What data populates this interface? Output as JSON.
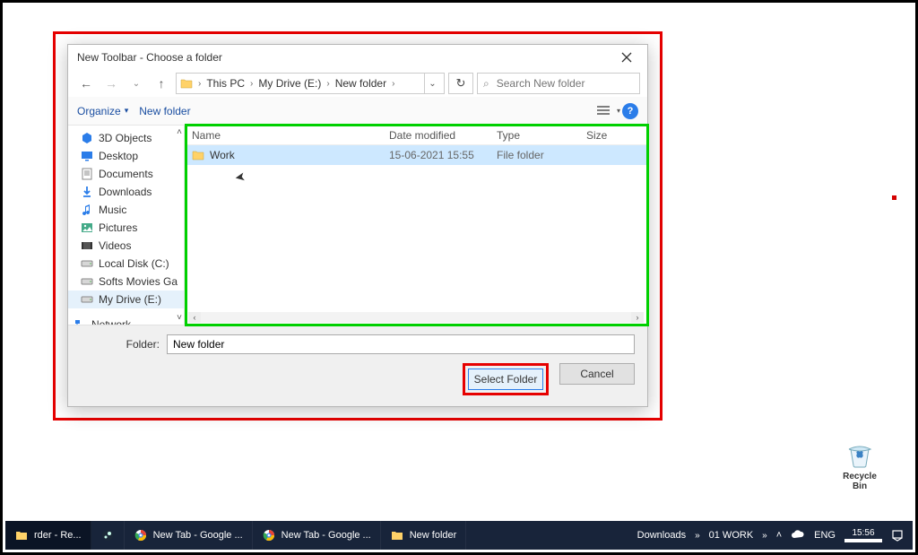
{
  "dialog": {
    "title": "New Toolbar - Choose a folder",
    "breadcrumb": {
      "root": "This PC",
      "drive": "My Drive (E:)",
      "folder": "New folder"
    },
    "search_placeholder": "Search New folder",
    "commands": {
      "organize": "Organize",
      "newfolder": "New folder"
    },
    "tree": [
      {
        "label": "3D Objects",
        "icon": "cube",
        "color": "#2b7de9"
      },
      {
        "label": "Desktop",
        "icon": "desktop",
        "color": "#2b7de9"
      },
      {
        "label": "Documents",
        "icon": "doc",
        "color": "#6d6d6d"
      },
      {
        "label": "Downloads",
        "icon": "download",
        "color": "#2b7de9"
      },
      {
        "label": "Music",
        "icon": "music",
        "color": "#2b7de9"
      },
      {
        "label": "Pictures",
        "icon": "picture",
        "color": "#4a8"
      },
      {
        "label": "Videos",
        "icon": "video",
        "color": "#555"
      },
      {
        "label": "Local Disk (C:)",
        "icon": "disk",
        "color": "#888"
      },
      {
        "label": "Softs Movies Ga",
        "icon": "disk",
        "color": "#888"
      },
      {
        "label": "My Drive (E:)",
        "icon": "disk",
        "color": "#888",
        "selected": true
      },
      {
        "label": "Network",
        "icon": "network",
        "color": "#2b7de9"
      }
    ],
    "columns": {
      "name": "Name",
      "date": "Date modified",
      "type": "Type",
      "size": "Size"
    },
    "rows": [
      {
        "name": "Work",
        "date": "15-06-2021 15:55",
        "type": "File folder",
        "size": ""
      }
    ],
    "folder_label": "Folder:",
    "folder_value": "New folder",
    "select": "Select Folder",
    "cancel": "Cancel"
  },
  "desktop": {
    "recycle": "Recycle Bin"
  },
  "taskbar": {
    "items": [
      {
        "label": "rder - Re...",
        "icon": "folder"
      },
      {
        "label": "",
        "icon": "steam"
      },
      {
        "label": "New Tab - Google ...",
        "icon": "chrome"
      },
      {
        "label": "New Tab - Google ...",
        "icon": "chrome"
      },
      {
        "label": "New folder",
        "icon": "folder"
      }
    ],
    "tray": {
      "downloads": "Downloads",
      "work": "01 WORK",
      "lang": "ENG",
      "time": "15:56"
    }
  }
}
